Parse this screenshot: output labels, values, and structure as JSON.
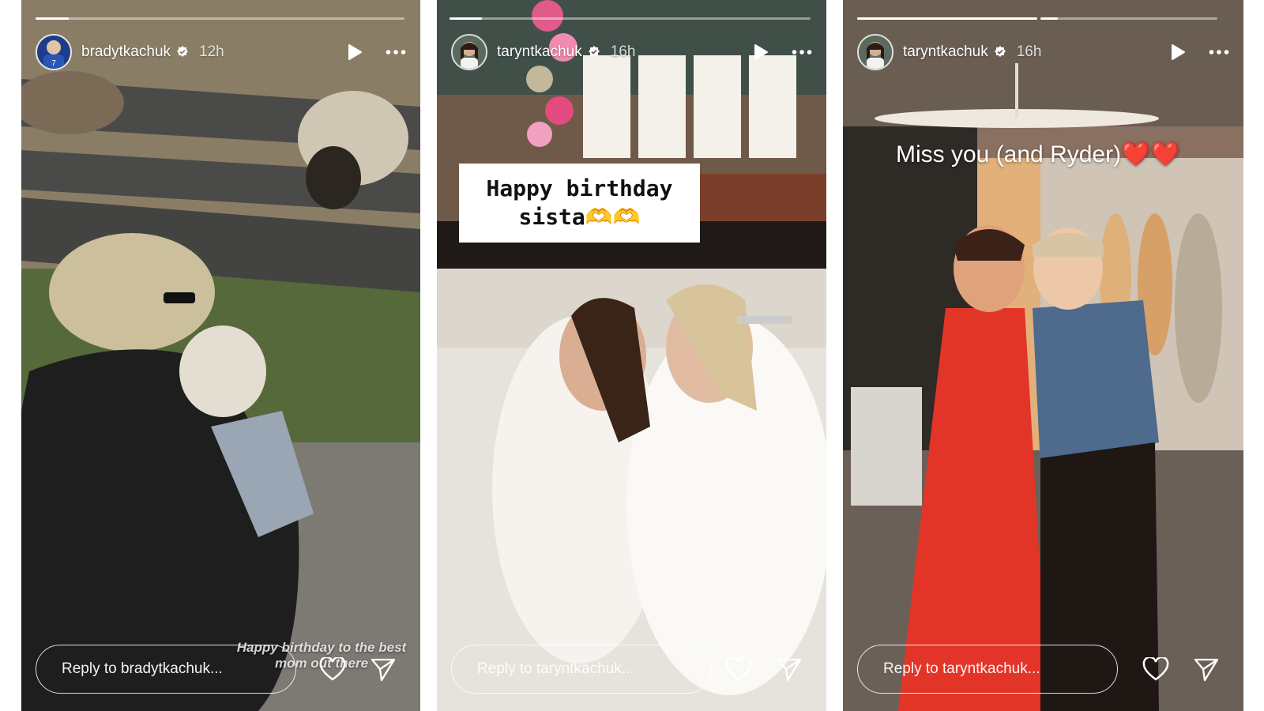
{
  "stories": [
    {
      "username": "bradytkachuk",
      "time": "12h",
      "progress": 0.09,
      "reply_placeholder": "Reply to bradytkachuk...",
      "overlay_text": "Happy birthday to the best mom out there"
    },
    {
      "username": "taryntkachuk",
      "time": "16h",
      "progress": 0.09,
      "reply_placeholder": "Reply to taryntkachuk...",
      "caption": "Happy birthday\nsista🫶🫶"
    },
    {
      "username": "taryntkachuk",
      "time": "16h",
      "segments": [
        1.0,
        0.1
      ],
      "reply_placeholder": "Reply to taryntkachuk...",
      "overlay_text": "Miss you (and Ryder)❤️❤️"
    }
  ],
  "colors": {
    "ui_white": "#ffffff",
    "verified_blue": "#ffffff"
  },
  "icons": [
    "verified-badge-icon",
    "play-icon",
    "more-icon",
    "heart-icon",
    "send-icon"
  ]
}
